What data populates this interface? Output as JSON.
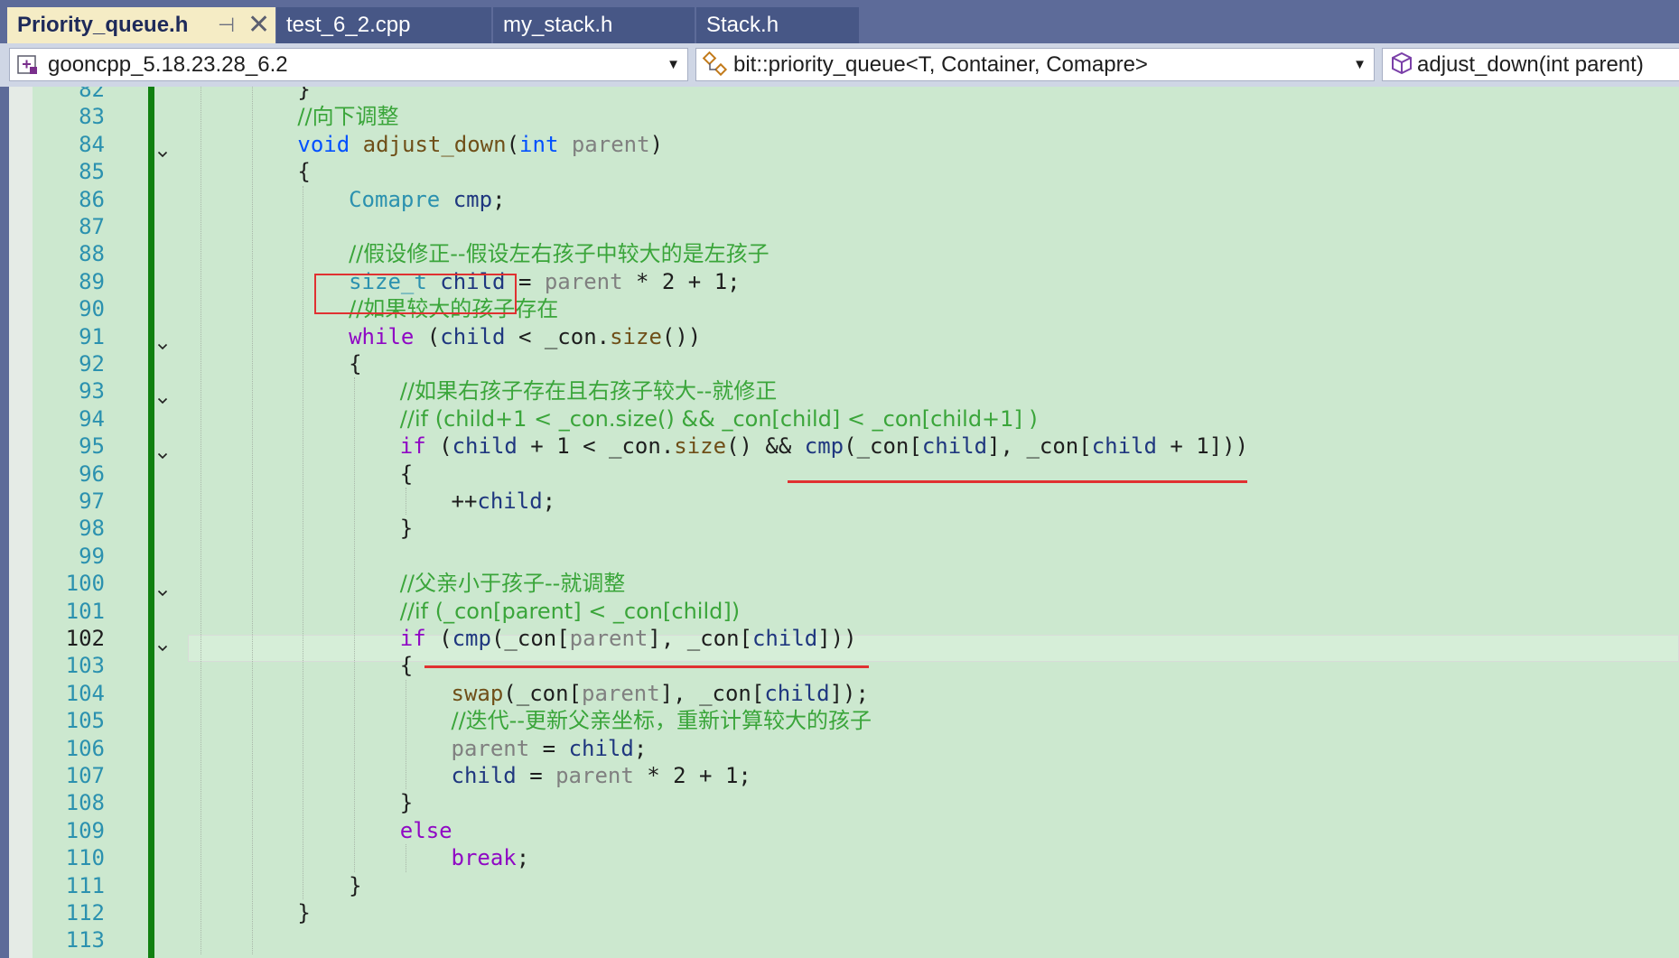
{
  "tabs": [
    {
      "label": "Priority_queue.h",
      "active": true,
      "pin_glyph": "⊣",
      "close_glyph": "✕"
    },
    {
      "label": "test_6_2.cpp",
      "active": false
    },
    {
      "label": "my_stack.h",
      "active": false
    },
    {
      "label": "Stack.h",
      "active": false
    }
  ],
  "navbar": {
    "project": "gooncpp_5.18.23.28_6.2",
    "project_icon": "project-icon",
    "scope": "bit::priority_queue<T, Container, Comapre>",
    "scope_icon": "class-icon",
    "member": "adjust_down(int parent)",
    "member_icon": "method-cube-icon",
    "dropdown_glyph": "▼"
  },
  "editor": {
    "current_line": 102,
    "colors": {
      "background": "#cce8cf",
      "line_number": "#2b91af",
      "comment": "#3aa53a",
      "keyword": "#0050ff",
      "control_keyword": "#8f08c4",
      "type": "#2b91af",
      "function": "#6f4f18",
      "local": "#1f377f",
      "parameter": "#808080",
      "change_bar": "#108010",
      "annotation": "#e03131"
    },
    "lines": [
      {
        "num": 82,
        "indent": 2,
        "fold": false,
        "tokens": [
          [
            "n",
            "}"
          ]
        ]
      },
      {
        "num": 83,
        "indent": 2,
        "fold": false,
        "tokens": [
          [
            "c",
            "//向下调整"
          ]
        ]
      },
      {
        "num": 84,
        "indent": 2,
        "fold": true,
        "tokens": [
          [
            "k",
            "void"
          ],
          [
            "n",
            " "
          ],
          [
            "f",
            "adjust_down"
          ],
          [
            "n",
            "("
          ],
          [
            "k",
            "int"
          ],
          [
            "n",
            " "
          ],
          [
            "p",
            "parent"
          ],
          [
            "n",
            ")"
          ]
        ]
      },
      {
        "num": 85,
        "indent": 2,
        "fold": false,
        "tokens": [
          [
            "n",
            "{"
          ]
        ]
      },
      {
        "num": 86,
        "indent": 3,
        "fold": false,
        "tokens": [
          [
            "t",
            "Comapre"
          ],
          [
            "n",
            " "
          ],
          [
            "l",
            "cmp"
          ],
          [
            "n",
            ";"
          ]
        ]
      },
      {
        "num": 87,
        "indent": 0,
        "fold": false,
        "tokens": []
      },
      {
        "num": 88,
        "indent": 3,
        "fold": false,
        "tokens": [
          [
            "c",
            "//假设修正--假设左右孩子中较大的是左孩子"
          ]
        ]
      },
      {
        "num": 89,
        "indent": 3,
        "fold": false,
        "tokens": [
          [
            "t",
            "size_t"
          ],
          [
            "n",
            " "
          ],
          [
            "l",
            "child"
          ],
          [
            "n",
            " = "
          ],
          [
            "p",
            "parent"
          ],
          [
            "n",
            " * 2 + 1;"
          ]
        ]
      },
      {
        "num": 90,
        "indent": 3,
        "fold": false,
        "tokens": [
          [
            "c",
            "//如果较大的孩子存在"
          ]
        ]
      },
      {
        "num": 91,
        "indent": 3,
        "fold": true,
        "tokens": [
          [
            "ctl",
            "while"
          ],
          [
            "n",
            " ("
          ],
          [
            "l",
            "child"
          ],
          [
            "n",
            " < "
          ],
          [
            "m",
            "_con"
          ],
          [
            "n",
            "."
          ],
          [
            "f",
            "size"
          ],
          [
            "n",
            "())"
          ]
        ]
      },
      {
        "num": 92,
        "indent": 3,
        "fold": false,
        "tokens": [
          [
            "n",
            "{"
          ]
        ]
      },
      {
        "num": 93,
        "indent": 4,
        "fold": true,
        "tokens": [
          [
            "c",
            "//如果右孩子存在且右孩子较大--就修正"
          ]
        ]
      },
      {
        "num": 94,
        "indent": 4,
        "fold": false,
        "tokens": [
          [
            "c",
            "//if (child+1 < _con.size() && _con[child] < _con[child+1] )"
          ]
        ]
      },
      {
        "num": 95,
        "indent": 4,
        "fold": true,
        "tokens": [
          [
            "ctl",
            "if"
          ],
          [
            "n",
            " ("
          ],
          [
            "l",
            "child"
          ],
          [
            "n",
            " + 1 < "
          ],
          [
            "m",
            "_con"
          ],
          [
            "n",
            "."
          ],
          [
            "f",
            "size"
          ],
          [
            "n",
            "() && "
          ],
          [
            "l",
            "cmp"
          ],
          [
            "n",
            "("
          ],
          [
            "m",
            "_con"
          ],
          [
            "n",
            "["
          ],
          [
            "l",
            "child"
          ],
          [
            "n",
            "], "
          ],
          [
            "m",
            "_con"
          ],
          [
            "n",
            "["
          ],
          [
            "l",
            "child"
          ],
          [
            "n",
            " + 1]))"
          ]
        ]
      },
      {
        "num": 96,
        "indent": 4,
        "fold": false,
        "tokens": [
          [
            "n",
            "{"
          ]
        ]
      },
      {
        "num": 97,
        "indent": 5,
        "fold": false,
        "tokens": [
          [
            "n",
            "++"
          ],
          [
            "l",
            "child"
          ],
          [
            "n",
            ";"
          ]
        ]
      },
      {
        "num": 98,
        "indent": 4,
        "fold": false,
        "tokens": [
          [
            "n",
            "}"
          ]
        ]
      },
      {
        "num": 99,
        "indent": 0,
        "fold": false,
        "tokens": []
      },
      {
        "num": 100,
        "indent": 4,
        "fold": true,
        "tokens": [
          [
            "c",
            "//父亲小于孩子--就调整"
          ]
        ]
      },
      {
        "num": 101,
        "indent": 4,
        "fold": false,
        "tokens": [
          [
            "c",
            "//if (_con[parent] < _con[child])"
          ]
        ]
      },
      {
        "num": 102,
        "indent": 4,
        "fold": true,
        "tokens": [
          [
            "ctl",
            "if"
          ],
          [
            "n",
            " ("
          ],
          [
            "l",
            "cmp"
          ],
          [
            "n",
            "("
          ],
          [
            "m",
            "_con"
          ],
          [
            "n",
            "["
          ],
          [
            "p",
            "parent"
          ],
          [
            "n",
            "], "
          ],
          [
            "m",
            "_con"
          ],
          [
            "n",
            "["
          ],
          [
            "l",
            "child"
          ],
          [
            "n",
            "]))"
          ]
        ]
      },
      {
        "num": 103,
        "indent": 4,
        "fold": false,
        "tokens": [
          [
            "n",
            "{"
          ]
        ]
      },
      {
        "num": 104,
        "indent": 5,
        "fold": false,
        "tokens": [
          [
            "f",
            "swap"
          ],
          [
            "n",
            "("
          ],
          [
            "m",
            "_con"
          ],
          [
            "n",
            "["
          ],
          [
            "p",
            "parent"
          ],
          [
            "n",
            "], "
          ],
          [
            "m",
            "_con"
          ],
          [
            "n",
            "["
          ],
          [
            "l",
            "child"
          ],
          [
            "n",
            "]);"
          ]
        ]
      },
      {
        "num": 105,
        "indent": 5,
        "fold": false,
        "tokens": [
          [
            "c",
            "//迭代--更新父亲坐标，重新计算较大的孩子"
          ]
        ]
      },
      {
        "num": 106,
        "indent": 5,
        "fold": false,
        "tokens": [
          [
            "p",
            "parent"
          ],
          [
            "n",
            " = "
          ],
          [
            "l",
            "child"
          ],
          [
            "n",
            ";"
          ]
        ]
      },
      {
        "num": 107,
        "indent": 5,
        "fold": false,
        "tokens": [
          [
            "l",
            "child"
          ],
          [
            "n",
            " = "
          ],
          [
            "p",
            "parent"
          ],
          [
            "n",
            " * 2 + 1;"
          ]
        ]
      },
      {
        "num": 108,
        "indent": 4,
        "fold": false,
        "tokens": [
          [
            "n",
            "}"
          ]
        ]
      },
      {
        "num": 109,
        "indent": 4,
        "fold": false,
        "tokens": [
          [
            "ctl",
            "else"
          ]
        ]
      },
      {
        "num": 110,
        "indent": 5,
        "fold": false,
        "tokens": [
          [
            "ctl",
            "break"
          ],
          [
            "n",
            ";"
          ]
        ]
      },
      {
        "num": 111,
        "indent": 3,
        "fold": false,
        "tokens": [
          [
            "n",
            "}"
          ]
        ]
      },
      {
        "num": 112,
        "indent": 2,
        "fold": false,
        "tokens": [
          [
            "n",
            "}"
          ]
        ]
      },
      {
        "num": 113,
        "indent": 0,
        "fold": false,
        "tokens": []
      }
    ]
  }
}
